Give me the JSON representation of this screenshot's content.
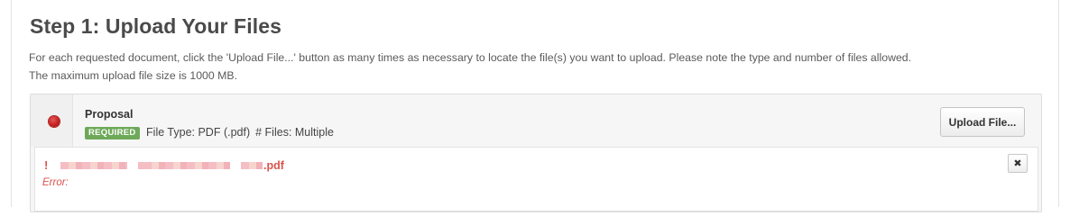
{
  "step": {
    "title": "Step 1: Upload Your Files",
    "instructions_line1": "For each requested document, click the 'Upload File...' button as many times as necessary to locate the file(s) you want to upload. Please note the type and number of files allowed.",
    "instructions_line2": "The maximum upload file size is 1000 MB."
  },
  "document": {
    "name": "Proposal",
    "status": "error",
    "status_icon": "red-dot-icon",
    "badge": "REQUIRED",
    "file_type": "File Type: PDF (.pdf)",
    "file_count": "# Files: Multiple",
    "upload_button_label": "Upload File...",
    "colors": {
      "badge": "#6ea95a",
      "error": "#d9534f",
      "status_dot": "#c52222"
    }
  },
  "uploaded_file": {
    "error_mark": "!",
    "extension": ".pdf",
    "error_label": "Error:",
    "remove_icon": "close-icon",
    "remove_glyph": "✖"
  }
}
